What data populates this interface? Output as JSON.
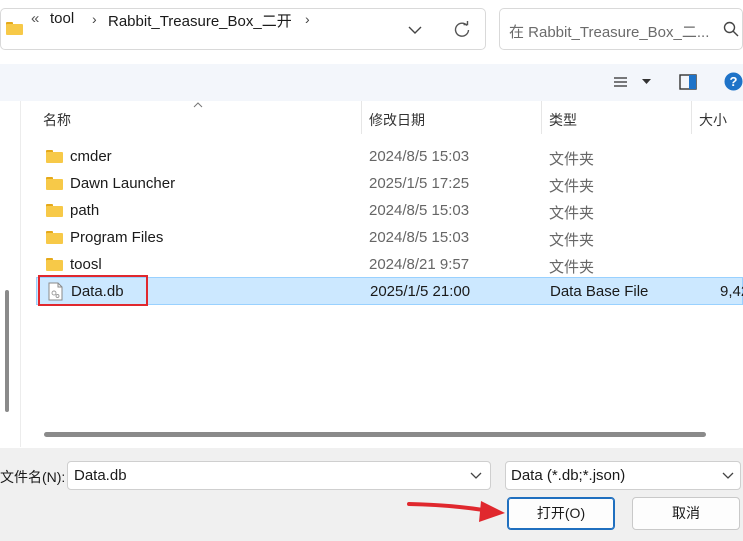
{
  "breadcrumb": {
    "overflow": "«",
    "items": [
      "tool",
      "Rabbit_Treasure_Box_二开"
    ]
  },
  "search": {
    "placeholder": "在 Rabbit_Treasure_Box_二..."
  },
  "columns": {
    "name": "名称",
    "modified": "修改日期",
    "type": "类型",
    "size": "大小"
  },
  "files": [
    {
      "name": "cmder",
      "modified": "2024/8/5 15:03",
      "type": "文件夹",
      "size": "",
      "kind": "folder",
      "selected": false
    },
    {
      "name": "Dawn Launcher",
      "modified": "2025/1/5 17:25",
      "type": "文件夹",
      "size": "",
      "kind": "folder",
      "selected": false
    },
    {
      "name": "path",
      "modified": "2024/8/5 15:03",
      "type": "文件夹",
      "size": "",
      "kind": "folder",
      "selected": false
    },
    {
      "name": "Program Files",
      "modified": "2024/8/5 15:03",
      "type": "文件夹",
      "size": "",
      "kind": "folder",
      "selected": false
    },
    {
      "name": "toosl",
      "modified": "2024/8/21 9:57",
      "type": "文件夹",
      "size": "",
      "kind": "folder",
      "selected": false
    },
    {
      "name": "Data.db",
      "modified": "2025/1/5 21:00",
      "type": "Data Base File",
      "size": "9,42",
      "kind": "file",
      "selected": true
    }
  ],
  "footer": {
    "filename_label": "文件名(N):",
    "filename_value": "Data.db",
    "filter_value": "Data (*.db;*.json)",
    "open_label": "打开(O)",
    "cancel_label": "取消"
  },
  "colors": {
    "selection": "#cce8ff",
    "highlight_box": "#e0282e",
    "arrow": "#e0282e"
  }
}
